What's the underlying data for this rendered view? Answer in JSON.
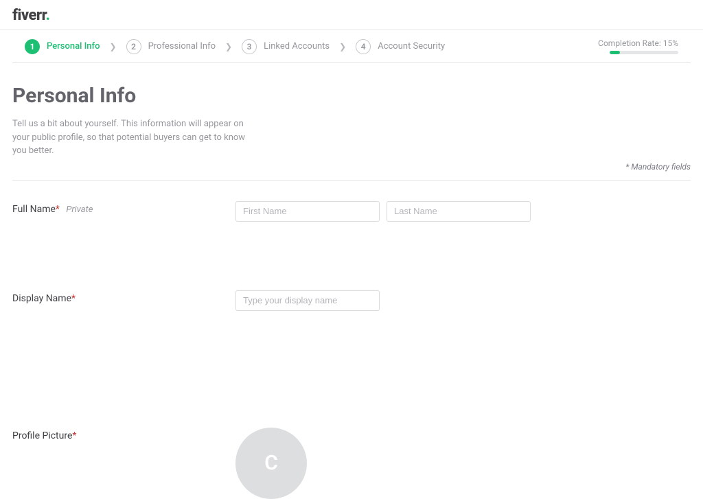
{
  "logo": {
    "text": "fiverr",
    "dot": "."
  },
  "stepper": {
    "steps": [
      {
        "num": "1",
        "label": "Personal Info"
      },
      {
        "num": "2",
        "label": "Professional Info"
      },
      {
        "num": "3",
        "label": "Linked Accounts"
      },
      {
        "num": "4",
        "label": "Account Security"
      }
    ]
  },
  "completion": {
    "label": "Completion Rate: 15%",
    "percent": 15
  },
  "header": {
    "title": "Personal Info",
    "subtitle": "Tell us a bit about yourself. This information will appear on your public profile, so that potential buyers can get to know you better.",
    "mandatory_note": "* Mandatory fields"
  },
  "fields": {
    "full_name": {
      "label": "Full Name",
      "private": "Private",
      "first_placeholder": "First Name",
      "last_placeholder": "Last Name",
      "first_value": "",
      "last_value": ""
    },
    "display_name": {
      "label": "Display Name",
      "placeholder": "Type your display name",
      "value": ""
    },
    "profile_picture": {
      "label": "Profile Picture",
      "initial": "C"
    }
  }
}
